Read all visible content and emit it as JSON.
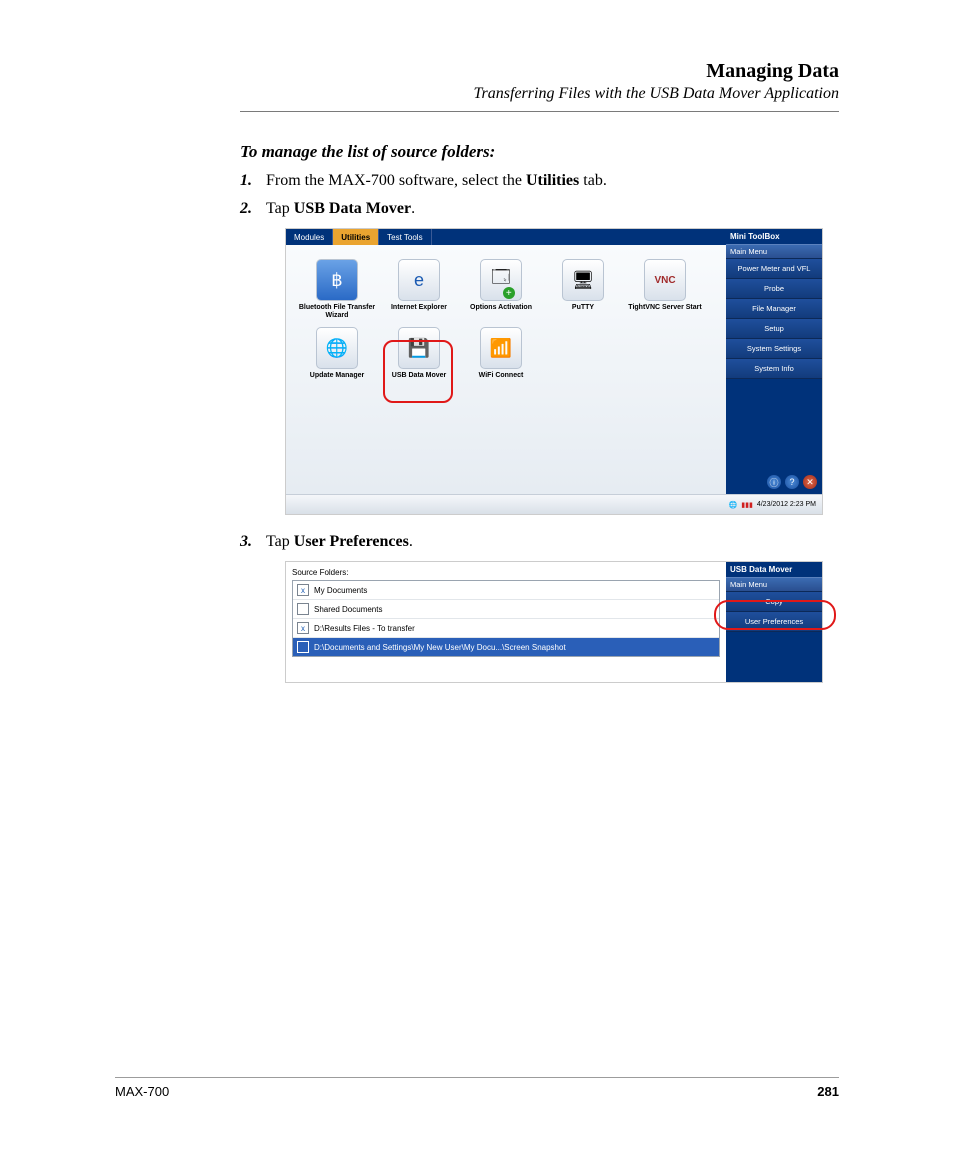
{
  "header": {
    "title": "Managing Data",
    "subtitle": "Transferring Files with the USB Data Mover Application"
  },
  "section_title": "To manage the list of source folders:",
  "steps": {
    "s1": {
      "num": "1.",
      "pre": "From the MAX-700 software, select the ",
      "bold": "Utilities",
      "post": " tab."
    },
    "s2": {
      "num": "2.",
      "pre": "Tap ",
      "bold": "USB Data Mover",
      "post": "."
    },
    "s3": {
      "num": "3.",
      "pre": "Tap ",
      "bold": "User Preferences",
      "post": "."
    }
  },
  "shot1": {
    "tabs": {
      "modules": "Modules",
      "utilities": "Utilities",
      "testtools": "Test Tools"
    },
    "icons": {
      "bluetooth": "Bluetooth File Transfer Wizard",
      "ie": "Internet Explorer",
      "options": "Options Activation",
      "putty": "PuTTY",
      "tightvnc": "TightVNC Server Start",
      "update": "Update Manager",
      "usb": "USB Data Mover",
      "wifi": "WiFi Connect"
    },
    "side": {
      "title": "Mini ToolBox",
      "menuhead": "Main Menu",
      "items": [
        "Power Meter and VFL",
        "Probe",
        "File Manager",
        "Setup",
        "System Settings",
        "System Info"
      ]
    },
    "status": {
      "time": "4/23/2012 2:23 PM"
    }
  },
  "shot2": {
    "label": "Source Folders:",
    "items": {
      "i0": {
        "chk": "x",
        "text": "My Documents"
      },
      "i1": {
        "chk": "",
        "text": "Shared Documents"
      },
      "i2": {
        "chk": "x",
        "text": "D:\\Results Files - To transfer"
      },
      "i3": {
        "chk": "",
        "text": "D:\\Documents and Settings\\My New User\\My Docu...\\Screen Snapshot"
      }
    },
    "side": {
      "title": "USB Data Mover",
      "menuhead": "Main Menu",
      "items": [
        "Copy",
        "User Preferences"
      ]
    }
  },
  "footer": {
    "model": "MAX-700",
    "page": "281"
  }
}
